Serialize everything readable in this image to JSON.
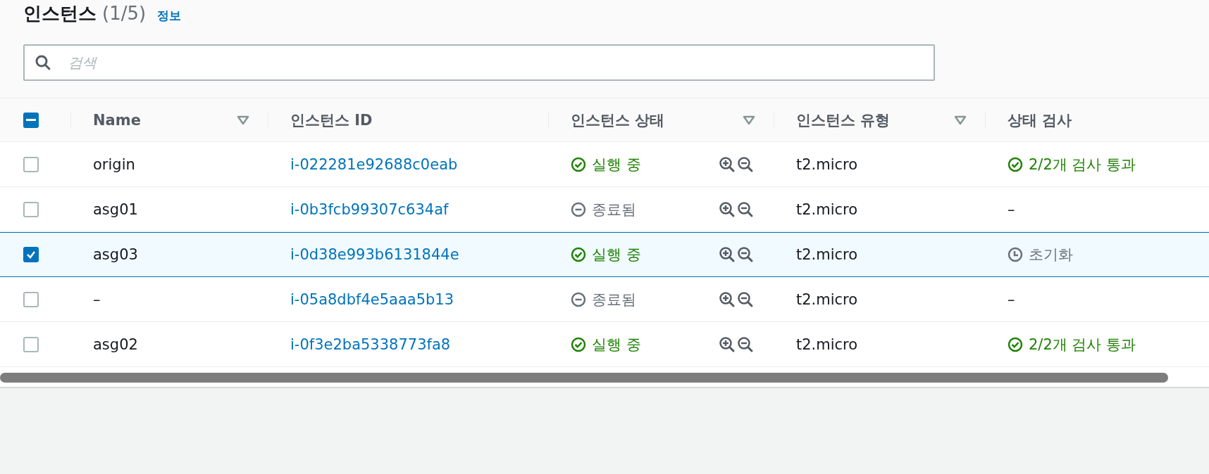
{
  "header": {
    "title": "인스턴스",
    "count": "(1/5)",
    "info_link": "정보"
  },
  "search": {
    "placeholder": "검색"
  },
  "table": {
    "select_all_indeterminate": true,
    "columns": [
      {
        "label": "Name",
        "sortable": true
      },
      {
        "label": "인스턴스 ID",
        "sortable": false
      },
      {
        "label": "인스턴스 상태",
        "sortable": true
      },
      {
        "label": "인스턴스 유형",
        "sortable": true
      },
      {
        "label": "상태 검사",
        "sortable": false
      }
    ],
    "rows": [
      {
        "selected": false,
        "name": "origin",
        "id": "i-022281e92688c0eab",
        "state": {
          "kind": "running",
          "label": "실행 중"
        },
        "type": "t2.micro",
        "check": {
          "kind": "passed",
          "label": "2/2개 검사 통과"
        }
      },
      {
        "selected": false,
        "name": "asg01",
        "id": "i-0b3fcb99307c634af",
        "state": {
          "kind": "terminated",
          "label": "종료됨"
        },
        "type": "t2.micro",
        "check": {
          "kind": "none",
          "label": "–"
        }
      },
      {
        "selected": true,
        "name": "asg03",
        "id": "i-0d38e993b6131844e",
        "state": {
          "kind": "running",
          "label": "실행 중"
        },
        "type": "t2.micro",
        "check": {
          "kind": "initializing",
          "label": "초기화"
        }
      },
      {
        "selected": false,
        "name": "–",
        "id": "i-05a8dbf4e5aaa5b13",
        "state": {
          "kind": "terminated",
          "label": "종료됨"
        },
        "type": "t2.micro",
        "check": {
          "kind": "none",
          "label": "–"
        }
      },
      {
        "selected": false,
        "name": "asg02",
        "id": "i-0f3e2ba5338773fa8",
        "state": {
          "kind": "running",
          "label": "실행 중"
        },
        "type": "t2.micro",
        "check": {
          "kind": "passed",
          "label": "2/2개 검사 통과"
        }
      }
    ]
  }
}
